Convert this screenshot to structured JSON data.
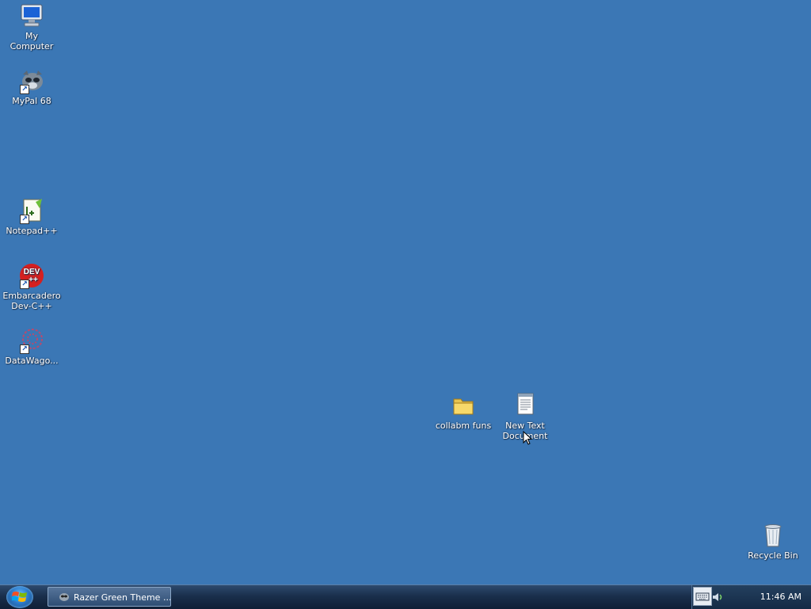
{
  "desktop": {
    "icons": [
      {
        "label": "My Computer",
        "icon": "computer-icon"
      },
      {
        "label": "MyPal 68",
        "icon": "mypal-icon"
      },
      {
        "label": "Notepad++",
        "icon": "notepadpp-icon"
      },
      {
        "label": "Embarcadero Dev-C++",
        "icon": "devcpp-icon",
        "badge": "DEV\n++"
      },
      {
        "label": "DataWago...",
        "icon": "datawago-icon"
      },
      {
        "label": "collabm funs",
        "icon": "folder-icon"
      },
      {
        "label": "New Text Document",
        "icon": "text-document-icon"
      },
      {
        "label": "Recycle Bin",
        "icon": "recycle-bin-icon"
      }
    ]
  },
  "taskbar": {
    "open_window": "Razer Green Theme ...",
    "clock": "11:46 AM"
  },
  "colors": {
    "desktop_bg": "#3b77b5",
    "taskbar_bg": "#1a2f4c"
  }
}
